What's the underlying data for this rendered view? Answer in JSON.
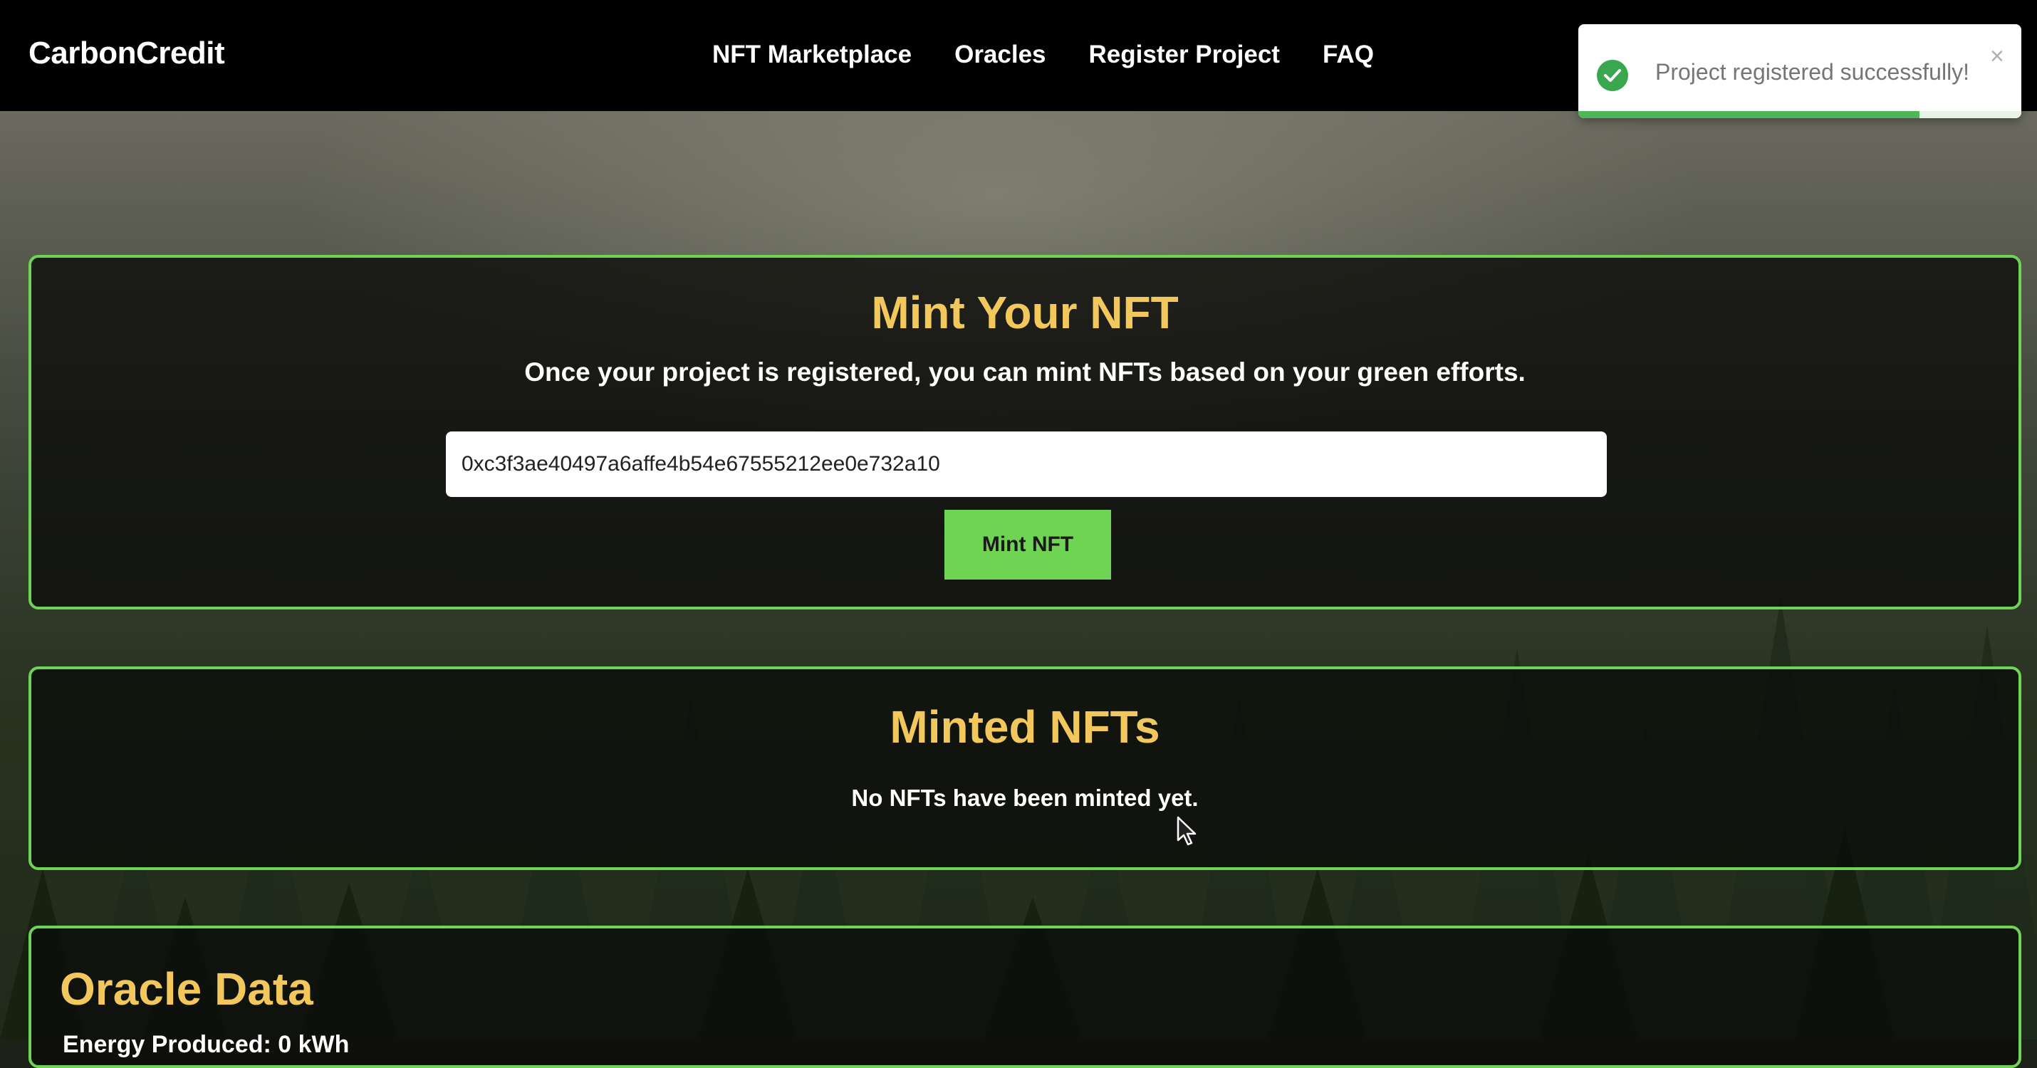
{
  "brand": "CarbonCredit",
  "nav": {
    "items": [
      "NFT Marketplace",
      "Oracles",
      "Register Project",
      "FAQ"
    ]
  },
  "toast": {
    "message": "Project registered successfully!",
    "close": "×",
    "progress_fraction": 0.77,
    "icon": "check-circle-icon"
  },
  "mint": {
    "title": "Mint Your NFT",
    "subtitle": "Once your project is registered, you can mint NFTs based on your green efforts.",
    "address_value": "0xc3f3ae40497a6affe4b54e67555212ee0e732a10",
    "button_label": "Mint NFT"
  },
  "minted": {
    "title": "Minted NFTs",
    "empty_message": "No NFTs have been minted yet."
  },
  "oracle": {
    "title": "Oracle Data",
    "energy_line": "Energy Produced: 0 kWh"
  },
  "colors": {
    "accent_green": "#6fd354",
    "title_gold": "#f2c75c",
    "toast_success": "#3aa64e"
  }
}
